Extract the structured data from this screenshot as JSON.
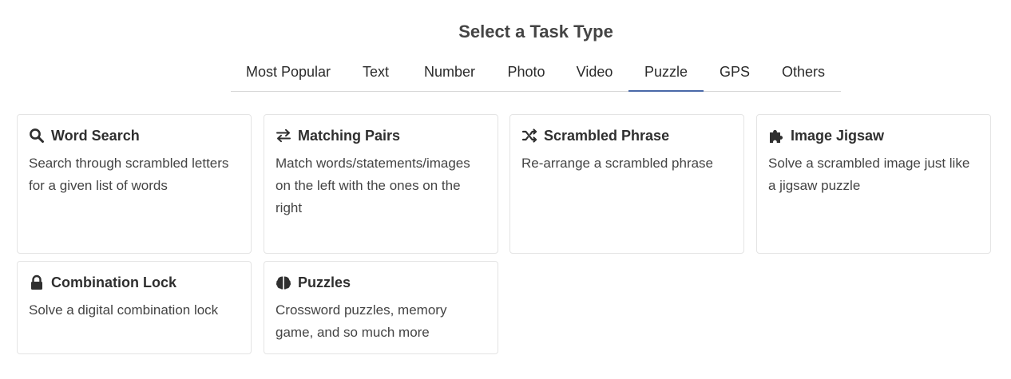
{
  "header": {
    "title": "Select a Task Type"
  },
  "tabs": [
    {
      "label": "Most Popular"
    },
    {
      "label": "Text"
    },
    {
      "label": "Number"
    },
    {
      "label": "Photo"
    },
    {
      "label": "Video"
    },
    {
      "label": "Puzzle",
      "active": true
    },
    {
      "label": "GPS"
    },
    {
      "label": "Others"
    }
  ],
  "accent_color": "#4a69a8",
  "cards": [
    {
      "icon": "search-icon",
      "title": "Word Search",
      "description": "Search through scrambled letters for a given list of words"
    },
    {
      "icon": "swap-arrows-icon",
      "title": "Matching Pairs",
      "description": "Match words/statements/images on the left with the ones on the right"
    },
    {
      "icon": "shuffle-icon",
      "title": "Scrambled Phrase",
      "description": "Re-arrange a scrambled phrase"
    },
    {
      "icon": "puzzle-piece-icon",
      "title": "Image Jigsaw",
      "description": "Solve a scrambled image just like a jigsaw puzzle"
    },
    {
      "icon": "lock-icon",
      "title": "Combination Lock",
      "description": "Solve a digital combination lock"
    },
    {
      "icon": "brain-icon",
      "title": "Puzzles",
      "description": "Crossword puzzles, memory game, and so much more"
    }
  ]
}
